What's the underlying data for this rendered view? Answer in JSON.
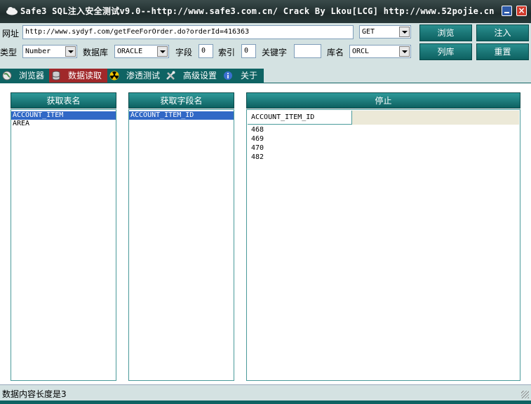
{
  "window": {
    "title": "Safe3 SQL注入安全测试v9.0--http://www.safe3.com.cn/   Crack By Lkou[LCG]  http://www.52pojie.cn"
  },
  "toolbar": {
    "url_label": "网址",
    "url_value": "http://www.sydyf.com/getFeeForOrder.do?orderId=416363",
    "method_value": "GET",
    "type_label": "类型",
    "type_value": "Number",
    "db_label": "数据库",
    "db_value": "ORACLE",
    "field_label": "字段",
    "field_value": "0",
    "index_label": "索引",
    "index_value": "0",
    "keyword_label": "关键字",
    "keyword_value": "",
    "dbname_label": "库名",
    "dbname_value": "ORCL",
    "browse_button": "浏览",
    "inject_button": "注入",
    "listdb_button": "列库",
    "reset_button": "重置"
  },
  "tabs": [
    {
      "label": "浏览器",
      "icon": "globe-icon"
    },
    {
      "label": "数据读取",
      "icon": "database-icon"
    },
    {
      "label": "渗透测试",
      "icon": "radiation-icon"
    },
    {
      "label": "高级设置",
      "icon": "tools-icon"
    },
    {
      "label": "关于",
      "icon": "info-icon"
    }
  ],
  "panels": {
    "tables_button": "获取表名",
    "tables": [
      "ACCOUNT_ITEM",
      "AREA"
    ],
    "fields_button": "获取字段名",
    "fields": [
      "ACCOUNT_ITEM_ID"
    ],
    "stop_button": "停止",
    "data_column": "ACCOUNT_ITEM_ID",
    "data_rows": [
      "468",
      "469",
      "470",
      "482"
    ]
  },
  "status": {
    "text": "数据内容长度是3"
  }
}
